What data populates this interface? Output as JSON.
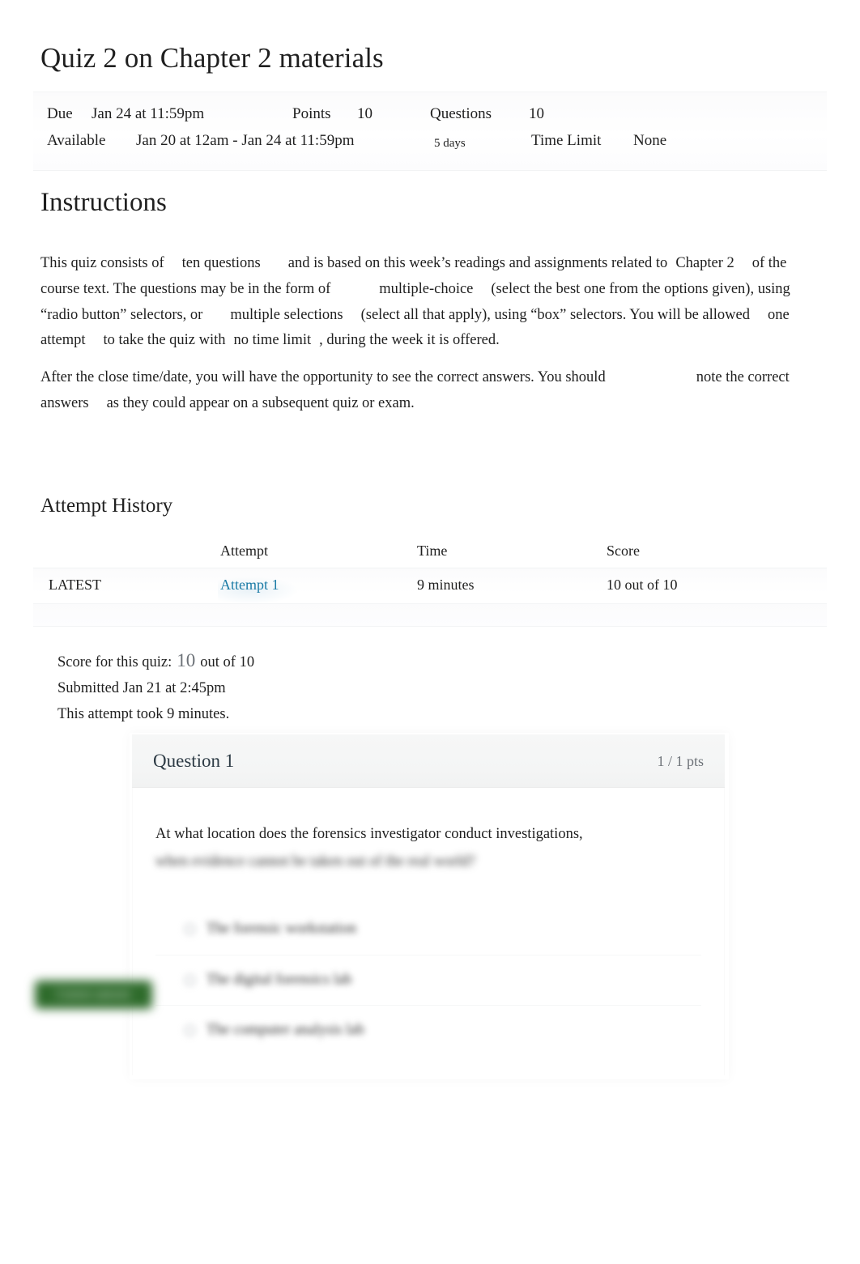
{
  "quiz": {
    "title": "Quiz 2 on Chapter 2 materials",
    "meta": {
      "due_label": "Due",
      "due_value": "Jan 24 at 11:59pm",
      "points_label": "Points",
      "points_value": "10",
      "questions_label": "Questions",
      "questions_value": "10",
      "available_label": "Available",
      "available_value": "Jan 20 at 12am - Jan 24 at 11:59pm",
      "duration_value": "5 days",
      "time_limit_label": "Time Limit",
      "time_limit_value": "None"
    }
  },
  "instructions": {
    "heading": "Instructions",
    "p1_a": "This quiz consists of",
    "p1_b": "ten questions",
    "p1_c": "and is based on this week’s readings and assignments related to",
    "p1_d": "Chapter 2",
    "p1_e": "of the course text. The questions may be in the form of",
    "p1_f": "multiple-choice",
    "p1_g": "(select the best one from the options given), using “radio button” selectors, or",
    "p1_h": "multiple selections",
    "p1_i": "(select all that apply), using “box” selectors. You will be allowed",
    "p1_j": "one attempt",
    "p1_k": "to take the quiz with",
    "p1_l": "no time limit",
    "p1_m": ", during the week it is offered.",
    "p2_a": "After the close time/date, you will have the opportunity to see the correct answers. You should",
    "p2_b": "note the correct answers",
    "p2_c": "as they could appear on a subsequent quiz or exam."
  },
  "attempt_history": {
    "heading": "Attempt History",
    "columns": [
      "",
      "Attempt",
      "Time",
      "Score"
    ],
    "rows": [
      {
        "kept": "LATEST",
        "attempt": "Attempt 1",
        "time": "9 minutes",
        "score": "10 out of 10"
      }
    ],
    "link_color": "#1b7ba6"
  },
  "score_summary": {
    "score_label": "Score for this quiz:",
    "score_value": "10",
    "score_out_of": "out of 10",
    "submitted": "Submitted Jan 21 at 2:45pm",
    "duration": "This attempt took 9 minutes."
  },
  "question": {
    "title": "Question 1",
    "points": "1 / 1 pts",
    "text_line1": "At what location does the forensics investigator conduct investigations,",
    "text_line2": "when evidence cannot be taken out of the real world?",
    "options": [
      "The forensic workstation",
      "The digital forensics lab",
      "The computer analysis lab"
    ],
    "correct_badge": "Correct answer",
    "badge_color": "#2e6b2b"
  }
}
